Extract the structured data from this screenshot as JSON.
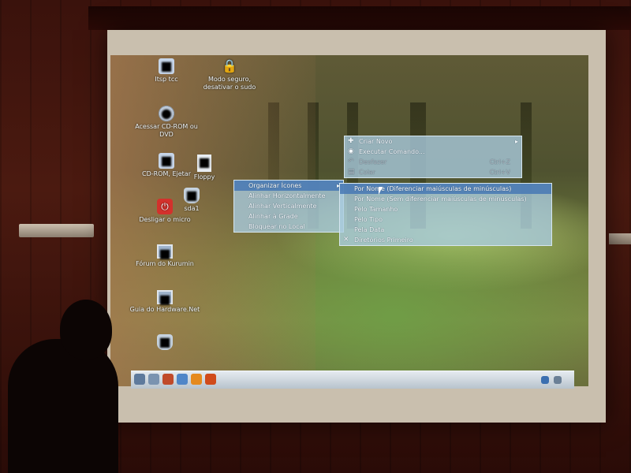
{
  "desktop_icons": [
    {
      "name": "itsp-tcc",
      "label": "Itsp tcc",
      "icon": "folder-icon"
    },
    {
      "name": "modo-seguro",
      "label": "Modo seguro, desativar o sudo",
      "icon": "lock-icon"
    },
    {
      "name": "acessar-cdrom",
      "label": "Acessar CD-ROM ou DVD",
      "icon": "disc-icon"
    },
    {
      "name": "cdrom-ejetar",
      "label": "CD-ROM, Ejetar",
      "icon": "eject-icon"
    },
    {
      "name": "floppy",
      "label": "Floppy",
      "icon": "document-icon"
    },
    {
      "name": "sda1",
      "label": "sda1",
      "icon": "drive-icon"
    },
    {
      "name": "desligar-micro",
      "label": "Desligar o micro",
      "icon": "power-icon"
    },
    {
      "name": "forum-kurumin",
      "label": "Fórum do Kurumin",
      "icon": "monitor-icon"
    },
    {
      "name": "guia-hardware",
      "label": "Guia do Hardware.Net",
      "icon": "monitor-icon"
    },
    {
      "name": "storage",
      "label": "",
      "icon": "storage-icon"
    }
  ],
  "main_menu": {
    "items": [
      {
        "label": "Criar Novo",
        "submenu": true
      },
      {
        "label": "Executar Comando..."
      },
      {
        "label": "Desfazer",
        "shortcut": "Ctrl+Z",
        "disabled": true
      },
      {
        "label": "Colar",
        "shortcut": "Ctrl+V",
        "disabled": true
      }
    ]
  },
  "arrange_menu": {
    "items": [
      {
        "label": "Organizar Ícones",
        "submenu": true,
        "active": true
      },
      {
        "label": "Alinhar Horizontalmente"
      },
      {
        "label": "Alinhar Verticalmente"
      },
      {
        "label": "Alinhar à Grade"
      },
      {
        "label": "Bloquear no Local"
      }
    ]
  },
  "sort_menu": {
    "items": [
      {
        "label": "Por Nome (Diferenciar maiúsculas de minúsculas)",
        "active": true
      },
      {
        "label": "Por Nome (Sem diferenciar maiúsculas de minúsculas)"
      },
      {
        "label": "Pelo Tamanho"
      },
      {
        "label": "Pelo Tipo"
      },
      {
        "label": "Pela Data"
      },
      {
        "label": "Diretórios Primeiro",
        "checked": true
      }
    ]
  },
  "colors": {
    "menu_bg": "#aacde1",
    "menu_active": "#4678b4",
    "taskbar": "#d4dde5"
  }
}
